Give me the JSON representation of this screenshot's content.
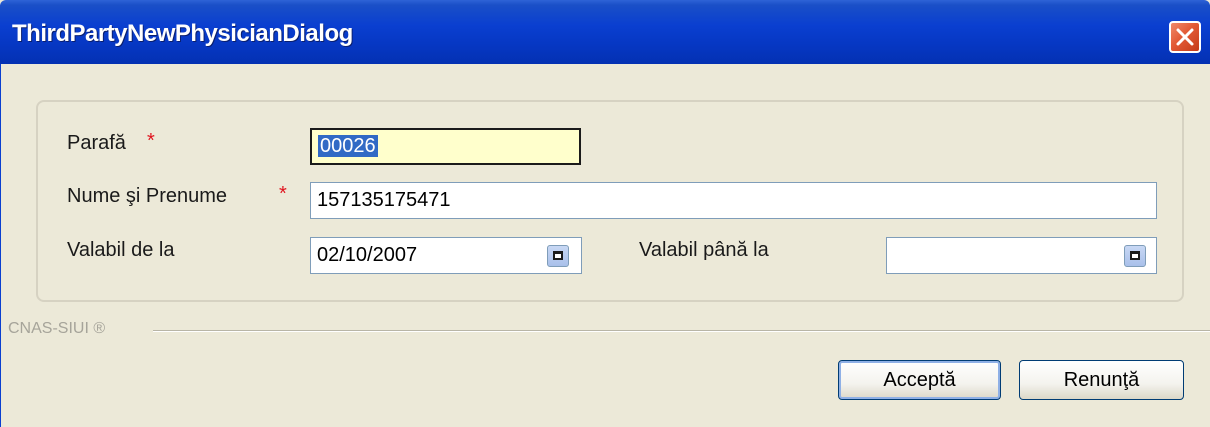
{
  "window": {
    "title": "ThirdPartyNewPhysicianDialog"
  },
  "form": {
    "parafa_label": "Parafă",
    "parafa_value": "00026",
    "nume_label": "Nume şi Prenume",
    "nume_value": "157135175471",
    "valabil_de_la_label": "Valabil de la",
    "valabil_de_la_value": "02/10/2007",
    "valabil_pana_la_label": "Valabil până la",
    "valabil_pana_la_value": "",
    "required_marker": "*"
  },
  "footer": {
    "brand": "CNAS-SIUI ®"
  },
  "buttons": {
    "accept": "Acceptă",
    "cancel": "Renunţă"
  },
  "icons": {
    "close": "close-icon",
    "calendar": "calendar-icon"
  },
  "colors": {
    "titlebar": "#0a3fd0",
    "required": "#e0141e",
    "focused_field_bg": "#ffffcc",
    "selection": "#316ac5"
  }
}
